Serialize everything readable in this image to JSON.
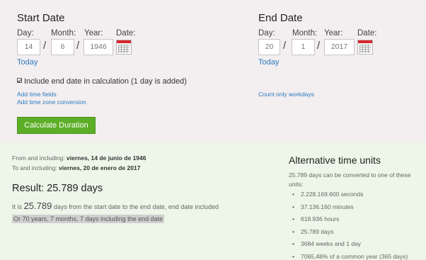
{
  "start": {
    "title": "Start Date",
    "labels": {
      "day": "Day:",
      "month": "Month:",
      "year": "Year:",
      "date": "Date:"
    },
    "day": "14",
    "month": "6",
    "year": "1946",
    "today": "Today"
  },
  "end": {
    "title": "End Date",
    "labels": {
      "day": "Day:",
      "month": "Month:",
      "year": "Year:",
      "date": "Date:"
    },
    "day": "20",
    "month": "1",
    "year": "2017",
    "today": "Today"
  },
  "options": {
    "include_end_date": "Include end date in calculation (1 day is added)",
    "add_time_fields": "Add time fields",
    "add_time_zone": "Add time zone conversion",
    "count_workdays": "Count only workdays"
  },
  "calculate_label": "Calculate Duration",
  "result": {
    "from_prefix": "From and including:",
    "from_date": "viernes, 14 de junio de 1946",
    "to_prefix": "To and including:",
    "to_date": "viernes, 20 de enero de 2017",
    "title": "Result: 25.789 days",
    "desc_prefix": "It is",
    "desc_value": "25.789",
    "desc_suffix": "days from the start date to the end date, end date included",
    "highlight": "Or 70 years, 7 months, 7 days including the end date"
  },
  "alternative": {
    "title": "Alternative time units",
    "intro": "25.789 days can be converted to one of these units:",
    "items": [
      "2.228.169.600 seconds",
      "37.136.160 minutes",
      "618.936 hours",
      "25.789 days",
      "3684 weeks and 1 day",
      "7065,48% of a common year (365 days)"
    ]
  },
  "colors": {
    "form_background": "#f3eef0",
    "result_background": "#edf6e8",
    "button": "#5dae27",
    "link": "#2a7bbf",
    "calendar_accent": "#d8262c"
  },
  "icons": [
    "calendar-icon",
    "checkbox-checked"
  ]
}
